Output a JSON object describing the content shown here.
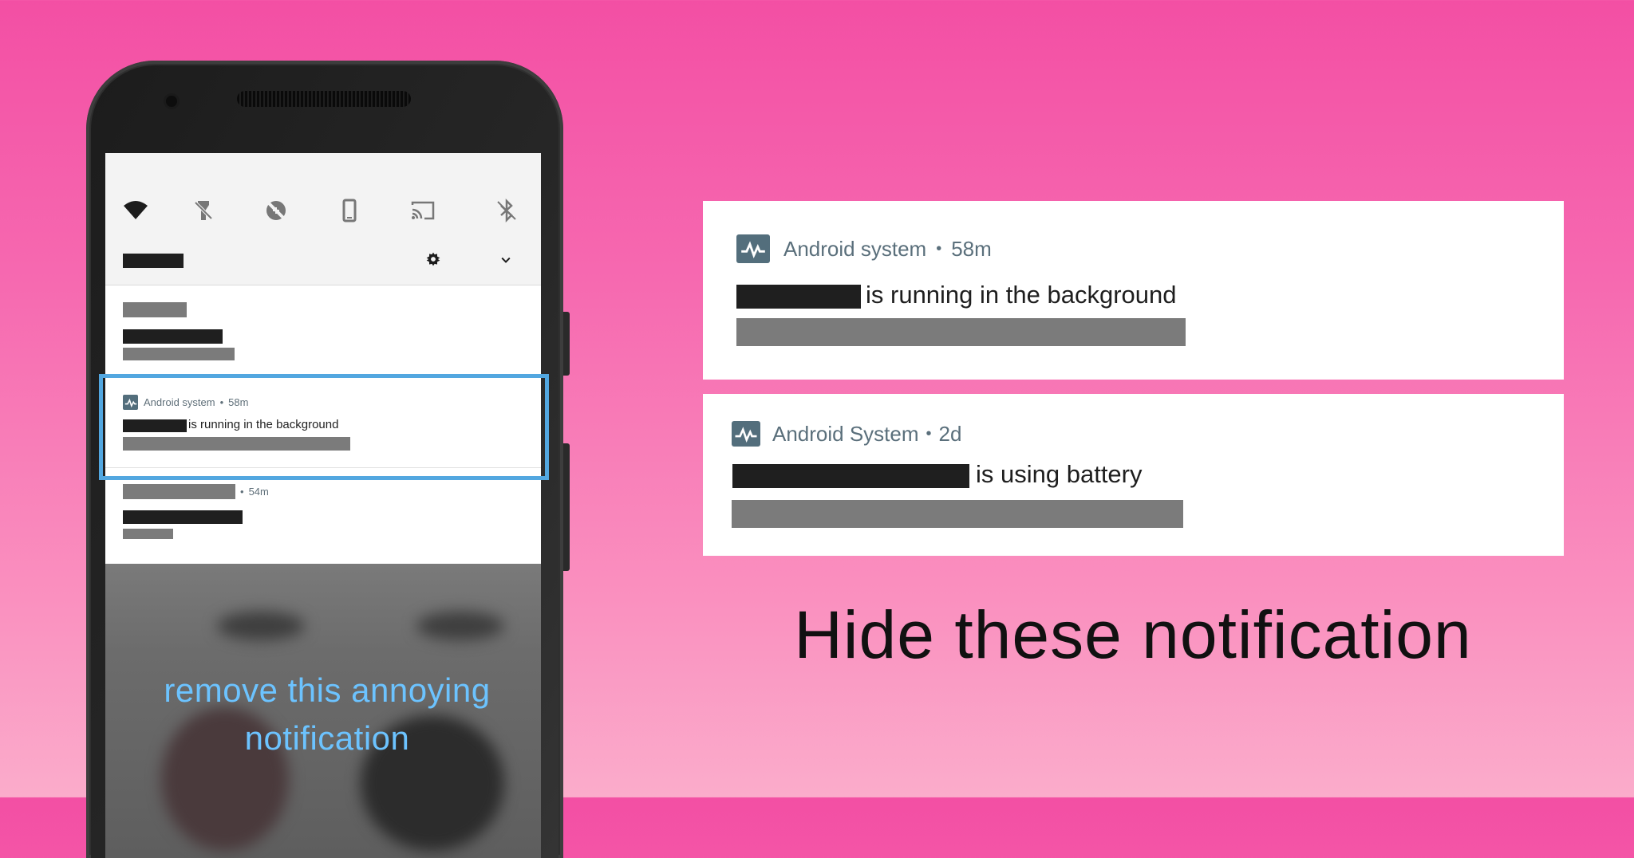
{
  "phone": {
    "notification_focus": {
      "app_name": "Android system",
      "time": "58m",
      "message": "is running in the background"
    },
    "notification_below": {
      "time": "54m"
    },
    "caption_line1": "remove this annoying",
    "caption_line2": "notification",
    "quick_settings_icons": [
      "wifi-icon",
      "flashlight-off-icon",
      "data-saver-off-icon",
      "portrait-rotation-icon",
      "cast-icon",
      "bluetooth-off-icon"
    ]
  },
  "cards": [
    {
      "app_name": "Android system",
      "time": "58m",
      "message": "is running in the background"
    },
    {
      "app_name": "Android System",
      "time": "2d",
      "message": "is using battery"
    }
  ],
  "separator": "•",
  "headline": "Hide these notification",
  "colors": {
    "highlight": "#52a7e0",
    "caption": "#6cc3ff",
    "app_icon": "#536e7c",
    "redaction_dark": "#1f1f1f",
    "redaction_gray": "#7b7b7b"
  }
}
